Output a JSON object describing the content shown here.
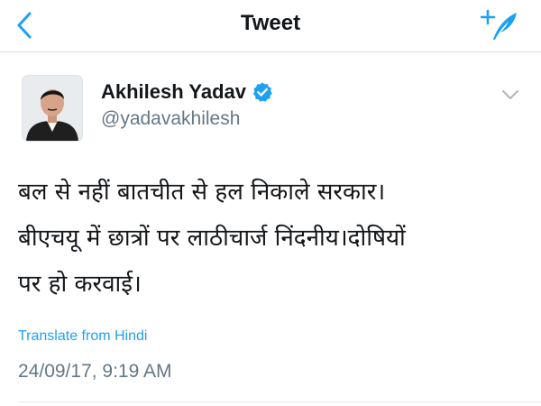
{
  "nav": {
    "title": "Tweet",
    "back_icon": "chevron-left-icon",
    "compose_icon": "compose-tweet-icon",
    "accent_color": "#1da1f2"
  },
  "tweet": {
    "author": {
      "name": "Akhilesh Yadav",
      "handle": "@yadavakhilesh",
      "verified": true
    },
    "text_lines": [
      "बल से नहीं बातचीत से हल निकाले सरकार।",
      "बीएचयू में छात्रों पर लाठीचार्ज निंदनीय।दोषियों",
      "पर हो करवाई।"
    ],
    "translate_label": "Translate from Hindi",
    "timestamp": "24/09/17, 9:19 AM"
  }
}
